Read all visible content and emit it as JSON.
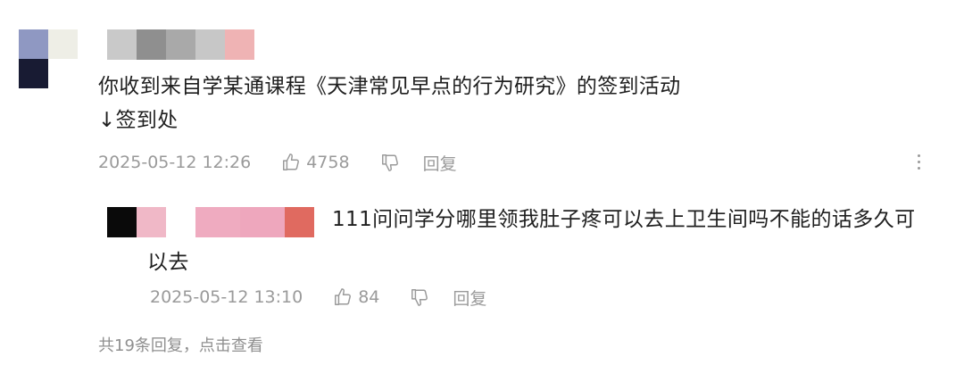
{
  "comment": {
    "text_line1": "你收到来自学某通课程《天津常见早点的行为研究》的签到活动",
    "text_line2": "↓签到处",
    "timestamp": "2025-05-12 12:26",
    "like_count": "4758",
    "reply_label": "回复"
  },
  "reply": {
    "text_line1": "111问问学分哪里领我肚子疼可以去上卫生间吗不能的话多久可",
    "text_line2": "以去",
    "timestamp": "2025-05-12 13:10",
    "like_count": "84",
    "reply_label": "回复"
  },
  "view_more_replies": "共19条回复，点击查看",
  "colors": {
    "text": "#1f1f1f",
    "meta": "#9a9a9a",
    "avatar_tl": "#8f98c2",
    "avatar_tr": "#eeeee6",
    "avatar_bl": "#181b33",
    "name_blocks_main": [
      "#c9c9c9",
      "#8f8f8f",
      "#a9a9a9",
      "#c7c7c7",
      "#efb3b4"
    ],
    "name_blocks_reply": [
      "#0a0a0a",
      "#f0b8c7",
      "#ffffff",
      "#efabc0",
      "#eea7bd",
      "#e06a60"
    ]
  },
  "icons": {
    "like": "thumbs-up-icon",
    "dislike": "thumbs-down-icon",
    "more": "more-vertical-icon"
  }
}
